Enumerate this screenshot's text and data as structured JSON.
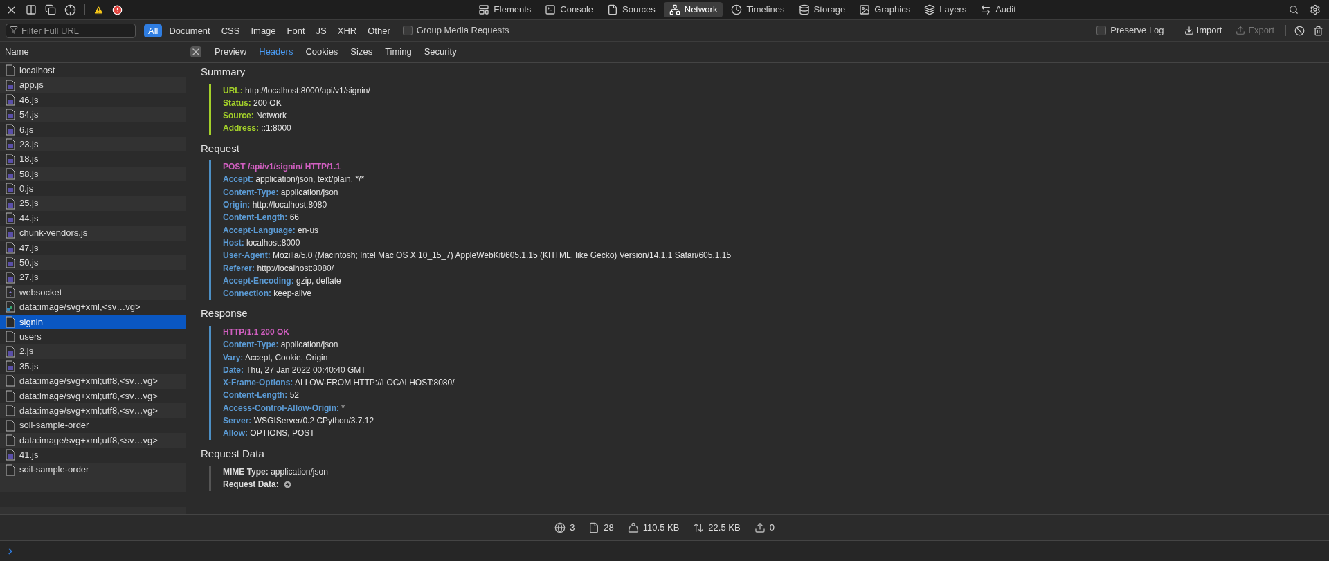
{
  "toolbar": {
    "tabs": [
      {
        "label": "Elements",
        "selected": false
      },
      {
        "label": "Console",
        "selected": false
      },
      {
        "label": "Sources",
        "selected": false
      },
      {
        "label": "Network",
        "selected": true
      },
      {
        "label": "Timelines",
        "selected": false
      },
      {
        "label": "Storage",
        "selected": false
      },
      {
        "label": "Graphics",
        "selected": false
      },
      {
        "label": "Layers",
        "selected": false
      },
      {
        "label": "Audit",
        "selected": false
      }
    ]
  },
  "filter_bar": {
    "search": {
      "placeholder": "Filter Full URL"
    },
    "types": [
      {
        "label": "All",
        "selected": true
      },
      {
        "label": "Document",
        "selected": false
      },
      {
        "label": "CSS",
        "selected": false
      },
      {
        "label": "Image",
        "selected": false
      },
      {
        "label": "Font",
        "selected": false
      },
      {
        "label": "JS",
        "selected": false
      },
      {
        "label": "XHR",
        "selected": false
      },
      {
        "label": "Other",
        "selected": false
      }
    ],
    "group_media": {
      "label": "Group Media Requests",
      "checked": false
    },
    "preserve_log": {
      "label": "Preserve Log",
      "checked": false
    },
    "import": {
      "label": "Import",
      "disabled": false
    },
    "export": {
      "label": "Export",
      "disabled": true
    }
  },
  "sidebar": {
    "column": "Name",
    "items": [
      {
        "name": "localhost",
        "kind": "document",
        "selected": false
      },
      {
        "name": "app.js",
        "kind": "js",
        "selected": false
      },
      {
        "name": "46.js",
        "kind": "js",
        "selected": false
      },
      {
        "name": "54.js",
        "kind": "js",
        "selected": false
      },
      {
        "name": "6.js",
        "kind": "js",
        "selected": false
      },
      {
        "name": "23.js",
        "kind": "js",
        "selected": false
      },
      {
        "name": "18.js",
        "kind": "js",
        "selected": false
      },
      {
        "name": "58.js",
        "kind": "js",
        "selected": false
      },
      {
        "name": "0.js",
        "kind": "js",
        "selected": false
      },
      {
        "name": "25.js",
        "kind": "js",
        "selected": false
      },
      {
        "name": "44.js",
        "kind": "js",
        "selected": false
      },
      {
        "name": "chunk-vendors.js",
        "kind": "js",
        "selected": false
      },
      {
        "name": "47.js",
        "kind": "js",
        "selected": false
      },
      {
        "name": "50.js",
        "kind": "js",
        "selected": false
      },
      {
        "name": "27.js",
        "kind": "js",
        "selected": false
      },
      {
        "name": "websocket",
        "kind": "websocket",
        "selected": false
      },
      {
        "name": "data:image/svg+xml,<sv…vg>",
        "kind": "image",
        "selected": false
      },
      {
        "name": "signin",
        "kind": "file",
        "selected": true
      },
      {
        "name": "users",
        "kind": "file",
        "selected": false
      },
      {
        "name": "2.js",
        "kind": "js",
        "selected": false
      },
      {
        "name": "35.js",
        "kind": "js",
        "selected": false
      },
      {
        "name": "data:image/svg+xml;utf8,<sv…vg>",
        "kind": "file",
        "selected": false
      },
      {
        "name": "data:image/svg+xml;utf8,<sv…vg>",
        "kind": "file",
        "selected": false
      },
      {
        "name": "data:image/svg+xml;utf8,<sv…vg>",
        "kind": "file",
        "selected": false
      },
      {
        "name": "soil-sample-order",
        "kind": "file",
        "selected": false
      },
      {
        "name": "data:image/svg+xml;utf8,<sv…vg>",
        "kind": "file",
        "selected": false
      },
      {
        "name": "41.js",
        "kind": "js",
        "selected": false
      },
      {
        "name": "soil-sample-order",
        "kind": "file",
        "selected": false
      }
    ]
  },
  "detail": {
    "tabs": [
      {
        "label": "Preview",
        "selected": false
      },
      {
        "label": "Headers",
        "selected": true
      },
      {
        "label": "Cookies",
        "selected": false
      },
      {
        "label": "Sizes",
        "selected": false
      },
      {
        "label": "Timing",
        "selected": false
      },
      {
        "label": "Security",
        "selected": false
      }
    ],
    "sections": [
      {
        "title": "Summary",
        "kind": "summary",
        "color": "#a4d12a",
        "lines": [
          {
            "key": "URL:",
            "value": "http://localhost:8000/api/v1/signin/"
          },
          {
            "key": "Status:",
            "value": "200 OK"
          },
          {
            "key": "Source:",
            "value": "Network"
          },
          {
            "key": "Address:",
            "value": "::1:8000"
          }
        ]
      },
      {
        "title": "Request",
        "kind": "headers",
        "color": "#4d8fc4",
        "first_line": "POST /api/v1/signin/ HTTP/1.1",
        "lines": [
          {
            "key": "Accept:",
            "value": "application/json, text/plain, */*"
          },
          {
            "key": "Content-Type:",
            "value": "application/json"
          },
          {
            "key": "Origin:",
            "value": "http://localhost:8080"
          },
          {
            "key": "Content-Length:",
            "value": "66"
          },
          {
            "key": "Accept-Language:",
            "value": "en-us"
          },
          {
            "key": "Host:",
            "value": "localhost:8000"
          },
          {
            "key": "User-Agent:",
            "value": "Mozilla/5.0 (Macintosh; Intel Mac OS X 10_15_7) AppleWebKit/605.1.15 (KHTML, like Gecko) Version/14.1.1 Safari/605.1.15"
          },
          {
            "key": "Referer:",
            "value": "http://localhost:8080/"
          },
          {
            "key": "Accept-Encoding:",
            "value": "gzip, deflate"
          },
          {
            "key": "Connection:",
            "value": "keep-alive"
          }
        ]
      },
      {
        "title": "Response",
        "kind": "headers",
        "color": "#4d8fc4",
        "first_line": "HTTP/1.1 200 OK",
        "lines": [
          {
            "key": "Content-Type:",
            "value": "application/json"
          },
          {
            "key": "Vary:",
            "value": "Accept, Cookie, Origin"
          },
          {
            "key": "Date:",
            "value": "Thu, 27 Jan 2022 00:40:40 GMT"
          },
          {
            "key": "X-Frame-Options:",
            "value": "ALLOW-FROM HTTP://LOCALHOST:8080/"
          },
          {
            "key": "Content-Length:",
            "value": "52"
          },
          {
            "key": "Access-Control-Allow-Origin:",
            "value": "*"
          },
          {
            "key": "Server:",
            "value": "WSGIServer/0.2 CPython/3.7.12"
          },
          {
            "key": "Allow:",
            "value": "OPTIONS, POST"
          }
        ]
      },
      {
        "title": "Request Data",
        "kind": "data",
        "color": "#555555",
        "lines": [
          {
            "key": "MIME Type:",
            "value": "application/json"
          },
          {
            "key": "Request Data:",
            "kind": "link"
          }
        ]
      }
    ]
  },
  "status_bar": [
    {
      "value": "3"
    },
    {
      "value": "28"
    },
    {
      "value": "110.5 KB"
    },
    {
      "value": "22.5 KB"
    },
    {
      "value": "0"
    }
  ]
}
